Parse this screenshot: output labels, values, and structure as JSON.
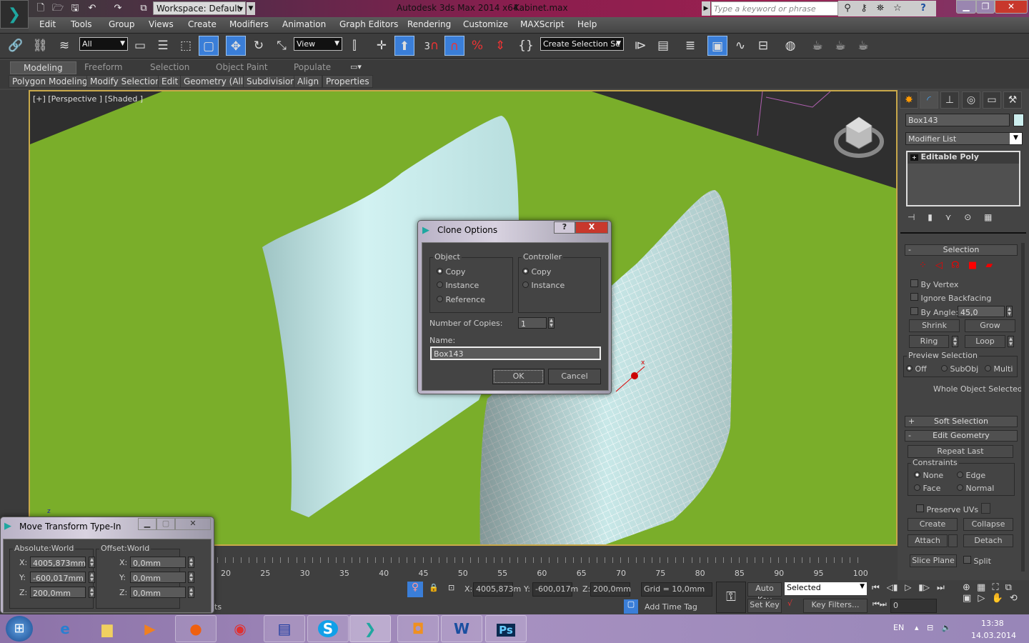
{
  "titlebar": {
    "app_title": "Autodesk 3ds Max  2014 x64",
    "file_name": "Kabinet.max",
    "workspace": "Workspace: Default",
    "search_placeholder": "Type a keyword or phrase"
  },
  "menu": [
    "Edit",
    "Tools",
    "Group",
    "Views",
    "Create",
    "Modifiers",
    "Animation",
    "Graph Editors",
    "Rendering",
    "Customize",
    "MAXScript",
    "Help"
  ],
  "toolbar": {
    "selection_filter": "All",
    "ref_coord": "View",
    "named_selection": "Create Selection Se",
    "snap_label": "3"
  },
  "ribbon": {
    "tabs": [
      "Modeling",
      "Freeform",
      "Selection",
      "Object Paint",
      "Populate"
    ],
    "active_tab": "Modeling",
    "panels": [
      "Polygon Modeling",
      "Modify Selection",
      "Edit",
      "Geometry (All)",
      "Subdivision",
      "Align",
      "Properties"
    ]
  },
  "viewport": {
    "label": "[+] [Perspective ] [Shaded ]",
    "colors": {
      "ground": "#7aae2a",
      "background": "#2f2f2f"
    }
  },
  "clone_dialog": {
    "title": "Clone Options",
    "help": "?",
    "close": "X",
    "object_group": "Object",
    "object_options": [
      "Copy",
      "Instance",
      "Reference"
    ],
    "object_selected": "Copy",
    "controller_group": "Controller",
    "controller_options": [
      "Copy",
      "Instance"
    ],
    "controller_selected": "Copy",
    "copies_label": "Number of Copies:",
    "copies_value": "1",
    "name_label": "Name:",
    "name_value": "Box143",
    "ok": "OK",
    "cancel": "Cancel"
  },
  "move_dialog": {
    "title": "Move Transform Type-In",
    "absolute_label": "Absolute:World",
    "offset_label": "Offset:World",
    "abs": {
      "x": "4005,873mm",
      "y": "-600,017mm",
      "z": "200,0mm"
    },
    "off": {
      "x": "0,0mm",
      "y": "0,0mm",
      "z": "0,0mm"
    },
    "axes": [
      "X:",
      "Y:",
      "Z:"
    ]
  },
  "command_panel": {
    "object_name": "Box143",
    "object_color": "#cdeeee",
    "modifier_list": "Modifier List",
    "stack_item": "Editable Poly",
    "selection": {
      "title": "Selection",
      "by_vertex": "By Vertex",
      "ignore_backfacing": "Ignore Backfacing",
      "by_angle": "By Angle:",
      "angle_value": "45,0",
      "shrink": "Shrink",
      "grow": "Grow",
      "ring": "Ring",
      "loop": "Loop",
      "preview_label": "Preview Selection",
      "preview_options": [
        "Off",
        "SubObj",
        "Multi"
      ],
      "preview_selected": "Off",
      "status": "Whole Object Selected"
    },
    "soft_selection": "Soft Selection",
    "edit_geometry": {
      "title": "Edit Geometry",
      "repeat_last": "Repeat Last",
      "constraints_label": "Constraints",
      "constraints": [
        "None",
        "Edge",
        "Face",
        "Normal"
      ],
      "constraint_selected": "None",
      "preserve_uvs": "Preserve UVs",
      "create": "Create",
      "collapse": "Collapse",
      "attach": "Attach",
      "detach": "Detach",
      "slice_plane": "Slice Plane",
      "split": "Split"
    }
  },
  "timeline": {
    "ticks": [
      "20",
      "25",
      "30",
      "35",
      "40",
      "45",
      "50",
      "55",
      "60",
      "65",
      "70",
      "75",
      "80",
      "85",
      "90",
      "95",
      "100"
    ]
  },
  "statusbar": {
    "x": "4005,873m",
    "y": "-600,017m",
    "z": "200,0mm",
    "x_label": "X:",
    "y_label": "Y:",
    "z_label": "Z:",
    "grid": "Grid = 10,0mm",
    "auto_key": "Auto Key",
    "set_key": "Set Key",
    "key_mode": "Selected",
    "key_filters": "Key Filters...",
    "add_time_tag": "Add Time Tag",
    "frame": "0",
    "prompt_fragment": "ts"
  },
  "taskbar": {
    "lang": "EN",
    "time": "13:38",
    "date": "14.03.2014"
  }
}
